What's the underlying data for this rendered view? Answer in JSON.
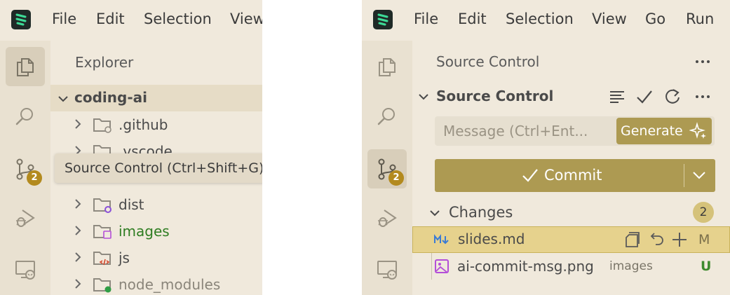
{
  "menu": [
    "File",
    "Edit",
    "Selection",
    "View",
    "Go",
    "Run"
  ],
  "explorer": {
    "title": "Explorer",
    "root": "coding-ai",
    "folders": [
      ".github",
      ".vscode",
      "",
      "dist",
      "images",
      "js",
      "node_modules"
    ],
    "images_color": "#2f7d22"
  },
  "tooltip": "Source Control (Ctrl+Shift+G)",
  "scm_badge": "2",
  "source_control": {
    "view_title": "Source Control",
    "section_title": "Source Control",
    "message_placeholder": "Message (Ctrl+Ent...",
    "generate_label": "Generate",
    "commit_label": "Commit",
    "changes_label": "Changes",
    "changes_count": "2",
    "files": [
      {
        "name": "slides.md",
        "folder": "",
        "status": "M",
        "icon": "markdown-icon"
      },
      {
        "name": "ai-commit-msg.png",
        "folder": "images",
        "status": "U",
        "icon": "image-icon"
      }
    ]
  },
  "colors": {
    "background": "#f0e9dc",
    "activity_bar": "#e9e1d1",
    "accent": "#ad9a52",
    "badge": "#b38a1e",
    "selected_row": "#e6d28d",
    "untracked": "#3d8a2e",
    "logo": "#1f2a27",
    "logo_mark": "#3ddc97"
  }
}
